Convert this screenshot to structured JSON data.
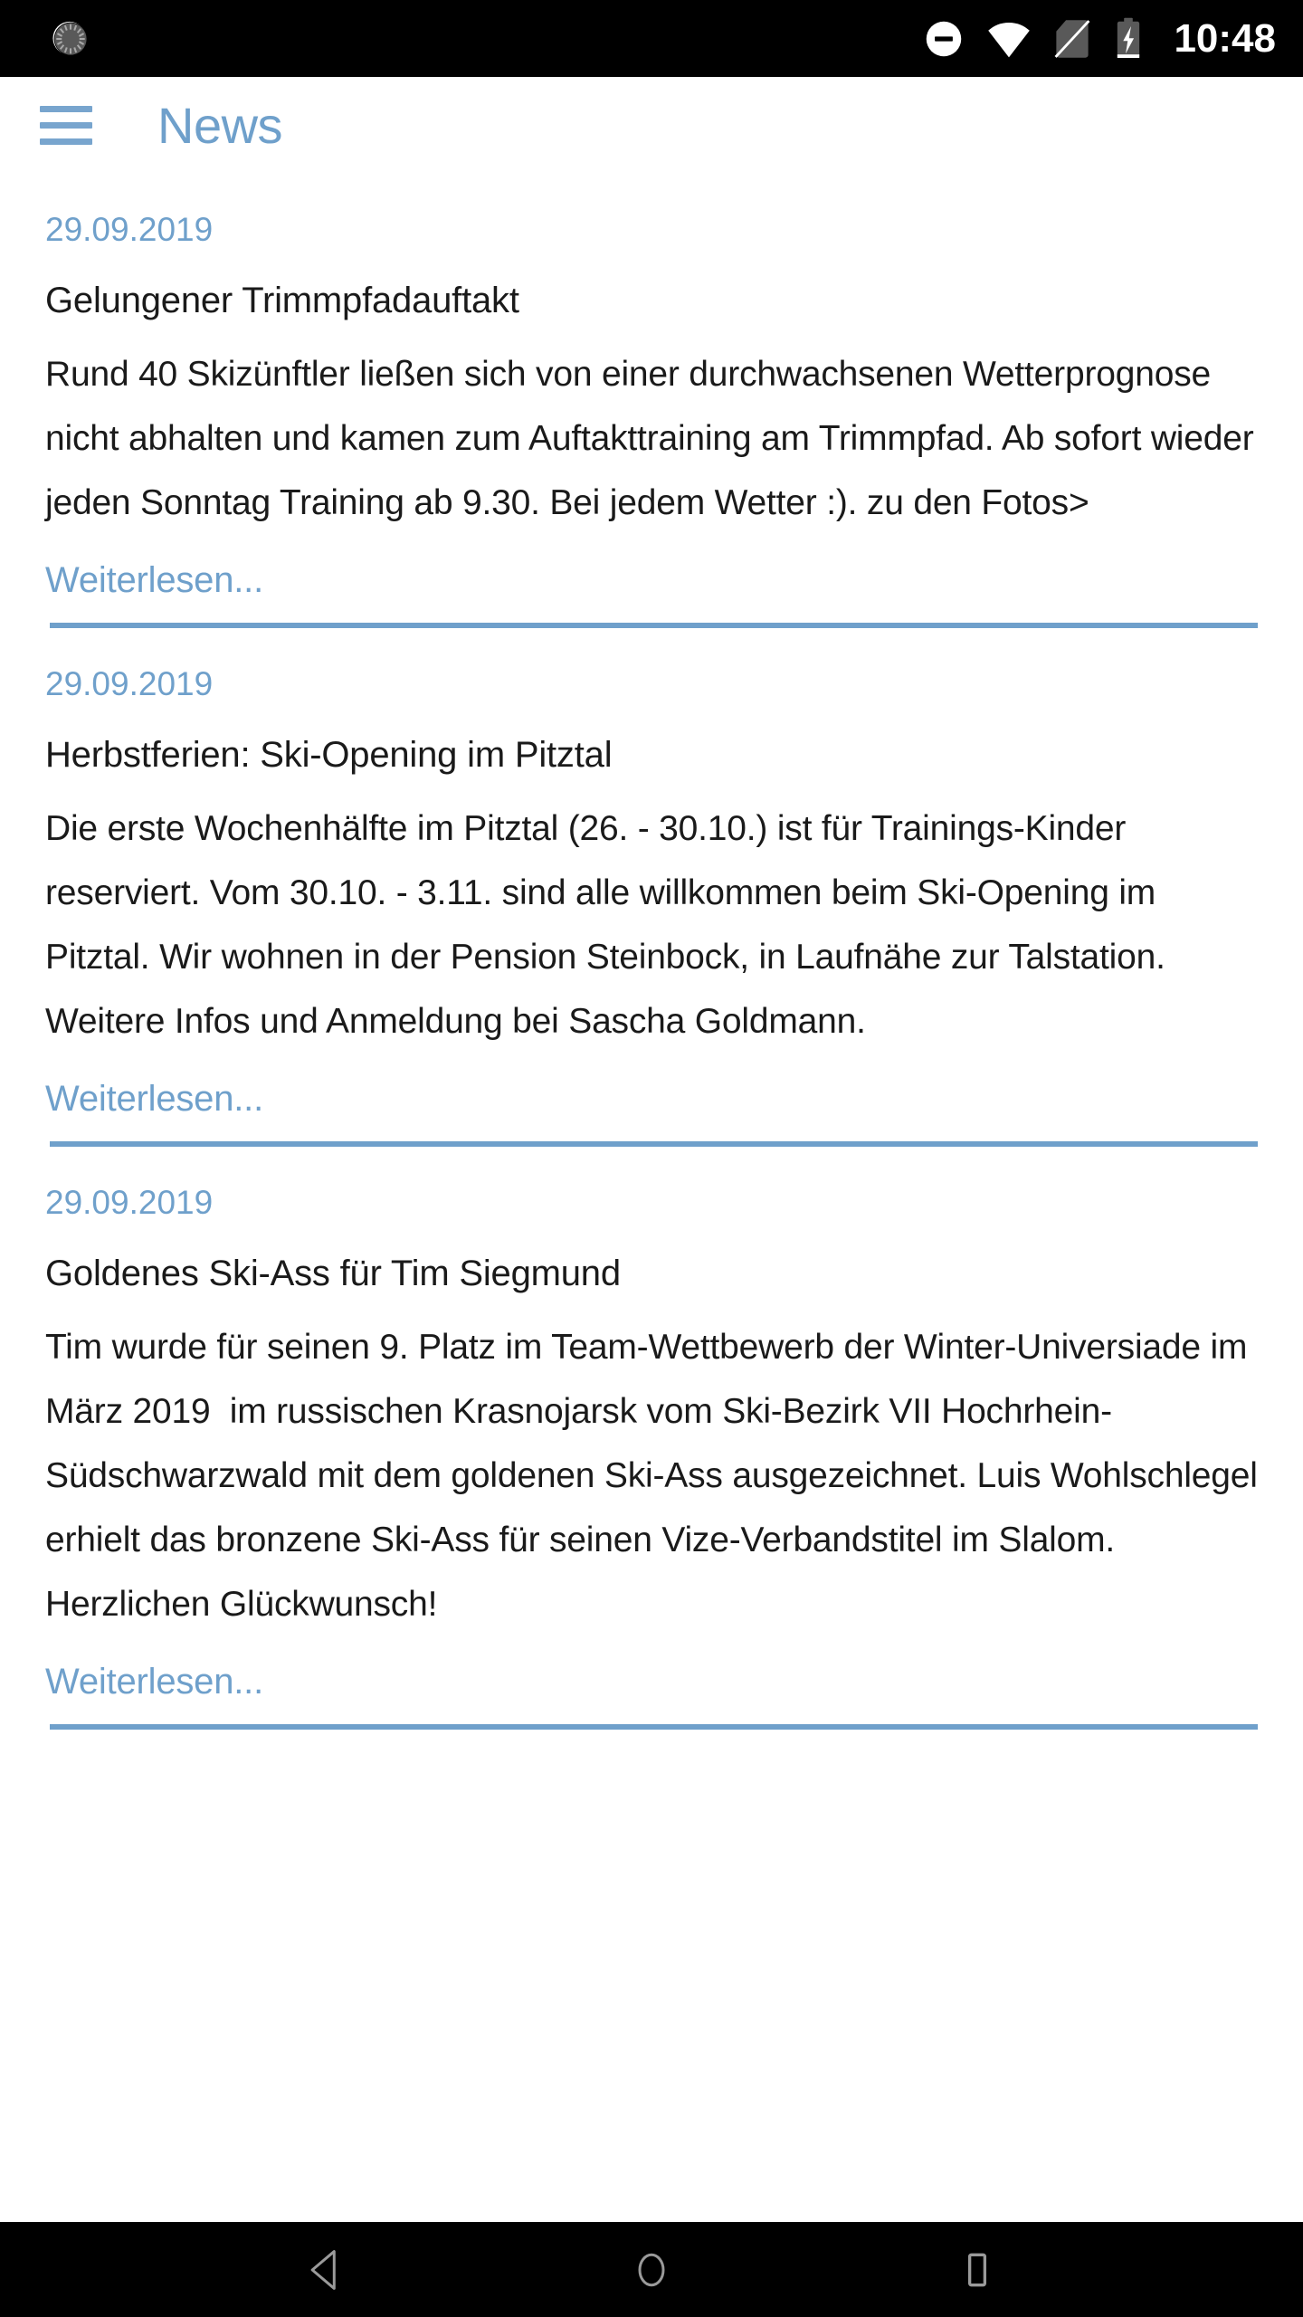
{
  "status_bar": {
    "left_icons": [
      {
        "name": "sync-spinner-icon",
        "label": "sync"
      }
    ],
    "right_icons": [
      {
        "name": "do-not-disturb-icon",
        "label": "do not disturb"
      },
      {
        "name": "wifi-icon",
        "label": "wifi"
      },
      {
        "name": "no-sim-icon",
        "label": "no sim card"
      },
      {
        "name": "battery-charging-icon",
        "label": "battery charging"
      }
    ],
    "clock": "10:48"
  },
  "app_bar": {
    "menu_icon": "hamburger-menu-icon",
    "title": "News"
  },
  "colors": {
    "accent_blue": "#6FA0CB",
    "text_black": "#1a1a1a",
    "system_black": "#000000",
    "page_white": "#ffffff"
  },
  "news": {
    "read_more_label": "Weiterlesen...",
    "items": [
      {
        "date": "29.09.2019",
        "title": "Gelungener Trimmpfadauftakt",
        "body": "Rund 40 Skizünftler ließen sich von einer durchwachsenen Wetterprognose nicht abhalten und kamen zum Auftakttraining am Trimmpfad. Ab sofort wieder jeden Sonntag Training ab 9.30. Bei jedem Wetter :). zu den Fotos>",
        "read_more": "Weiterlesen..."
      },
      {
        "date": "29.09.2019",
        "title": "Herbstferien: Ski-Opening im Pitztal",
        "body": "Die erste Wochenhälfte im Pitztal (26. - 30.10.) ist für Trainings-Kinder reserviert. Vom 30.10. - 3.11. sind alle willkommen beim Ski-Opening im Pitztal. Wir wohnen in der Pension Steinbock, in Laufnähe zur Talstation. Weitere Infos und Anmeldung bei Sascha Goldmann.",
        "read_more": "Weiterlesen..."
      },
      {
        "date": "29.09.2019",
        "title": "Goldenes Ski-Ass für Tim Siegmund",
        "body": "Tim wurde für seinen 9. Platz im Team-Wettbewerb der Winter-Universiade im März 2019  im russischen Krasnojarsk vom Ski-Bezirk VII Hochrhein-Südschwarzwald mit dem goldenen Ski-Ass ausgezeichnet. Luis Wohlschlegel erhielt das bronzene Ski-Ass für seinen Vize-Verbandstitel im Slalom. Herzlichen Glückwunsch!",
        "read_more": "Weiterlesen..."
      }
    ]
  },
  "nav_bar": {
    "back": "back-button",
    "home": "home-button",
    "recents": "recents-button"
  }
}
